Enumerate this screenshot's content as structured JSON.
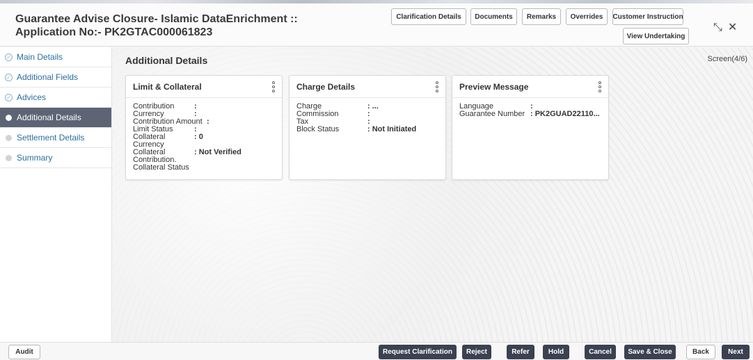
{
  "header": {
    "title_line1": "Guarantee Advise Closure- Islamic DataEnrichment ::",
    "title_line2": "Application No:- PK2GTAC000061823",
    "buttons": {
      "clarification": "Clarification Details",
      "documents": "Documents",
      "remarks": "Remarks",
      "overrides": "Overrides",
      "customer_instruction": "Customer Instruction",
      "view_undertaking": "View Undertaking"
    },
    "icons": {
      "resize": "⤡",
      "close": "✕"
    }
  },
  "sidebar": {
    "items": [
      {
        "label": "Main Details",
        "state": "done"
      },
      {
        "label": "Additional Fields",
        "state": "done"
      },
      {
        "label": "Advices",
        "state": "done"
      },
      {
        "label": "Additional Details",
        "state": "active"
      },
      {
        "label": "Settlement Details",
        "state": "pending"
      },
      {
        "label": "Summary",
        "state": "pending"
      }
    ]
  },
  "main": {
    "title": "Additional Details",
    "screen": "Screen(4/6)",
    "cards": {
      "limit": {
        "title": "Limit & Collateral",
        "rows": [
          {
            "label": "Contribution",
            "value": ":"
          },
          {
            "label": "Currency",
            "value": ":"
          },
          {
            "label": "Contribution Amount",
            "value": ":"
          },
          {
            "label": "Limit Status",
            "value": ":"
          },
          {
            "label": "Collateral Currency",
            "value": ": 0"
          },
          {
            "label": "Collateral",
            "value": ": Not Verified"
          },
          {
            "label": "Contribution.",
            "value": ""
          },
          {
            "label": "Collateral Status",
            "value": ""
          }
        ]
      },
      "charge": {
        "title": "Charge Details",
        "rows": [
          {
            "label": "Charge",
            "value": ": ..."
          },
          {
            "label": "Commission",
            "value": ":"
          },
          {
            "label": "Tax",
            "value": ":"
          },
          {
            "label": "Block Status",
            "value": ": Not Initiated"
          }
        ]
      },
      "preview": {
        "title": "Preview Message",
        "rows": [
          {
            "label": "Language",
            "value": ":"
          },
          {
            "label": "Guarantee Number",
            "value": ": PK2GUAD22110..."
          }
        ]
      }
    }
  },
  "footer": {
    "audit": "Audit",
    "request_clarification": "Request Clarification",
    "reject": "Reject",
    "refer": "Refer",
    "hold": "Hold",
    "cancel": "Cancel",
    "save_close": "Save & Close",
    "back": "Back",
    "next": "Next"
  },
  "colors": {
    "sidebar_active": "#5d6474",
    "sidebar_link": "#2a6e9e",
    "dark_button": "#3b4150"
  }
}
